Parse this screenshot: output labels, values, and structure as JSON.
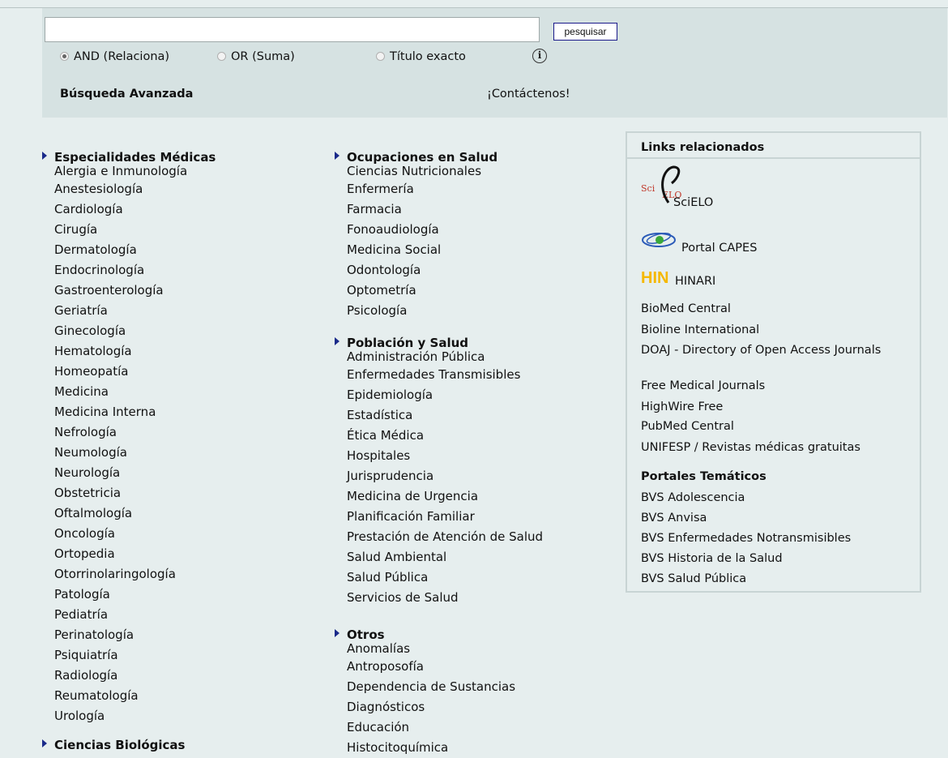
{
  "search": {
    "button_label": "pesquisar",
    "options": [
      "AND (Relaciona)",
      "OR (Suma)",
      "Título exacto"
    ],
    "selected_option": "AND (Relaciona)",
    "advanced_label": "Búsqueda Avanzada",
    "contact_label": "¡Contáctenos!"
  },
  "columns": {
    "especialidades": {
      "title": "Especialidades Médicas",
      "items": [
        "Alergia e Inmunología",
        "Anestesiología",
        "Cardiología",
        "Cirugía",
        "Dermatología",
        "Endocrinología",
        "Gastroenterología",
        "Geriatría",
        "Ginecología",
        "Hematología",
        "Homeopatía",
        "Medicina",
        "Medicina Interna",
        "Nefrología",
        "Neumología",
        "Neurología",
        "Obstetricia",
        "Oftalmología",
        "Oncología",
        "Ortopedia",
        "Otorrinolaringología",
        "Patología",
        "Pediatría",
        "Perinatología",
        "Psiquiatría",
        "Radiología",
        "Reumatología",
        "Urología"
      ]
    },
    "biologicas": {
      "title": "Ciencias Biológicas"
    },
    "ocupaciones": {
      "title": "Ocupaciones en Salud",
      "items": [
        "Ciencias Nutricionales",
        "Enfermería",
        "Farmacia",
        "Fonoaudiología",
        "Medicina Social",
        "Odontología",
        "Optometría",
        "Psicología"
      ]
    },
    "poblacion": {
      "title": "Población y Salud",
      "items": [
        "Administración Pública",
        "Enfermedades Transmisibles",
        "Epidemiología",
        "Estadística",
        "Ética Médica",
        "Hospitales",
        "Jurisprudencia",
        "Medicina de Urgencia",
        "Planificación Familiar",
        "Prestación de Atención de Salud",
        "Salud Ambiental",
        "Salud Pública",
        "Servicios de Salud"
      ]
    },
    "otros": {
      "title": "Otros",
      "items": [
        "Anomalías",
        "Antroposofía",
        "Dependencia de Sustancias",
        "Diagnósticos",
        "Educación",
        "Histocitoquímica"
      ]
    }
  },
  "related": {
    "title": "Links relacionados",
    "logo_links": [
      {
        "label": "SciELO",
        "icon": "scielo-logo"
      },
      {
        "label": "Portal CAPES",
        "icon": "capes-logo"
      },
      {
        "label": "HINARI",
        "icon": "hinari-logo",
        "logo_text": "HIN"
      }
    ],
    "links": [
      "BioMed Central",
      "Bioline International",
      "DOAJ - Directory of Open Access Journals",
      "Free Medical Journals",
      "HighWire Free",
      "PubMed Central",
      "UNIFESP / Revistas médicas gratuitas"
    ],
    "portales_title": "Portales Temáticos",
    "portales": [
      "BVS Adolescencia",
      "BVS Anvisa",
      "BVS Enfermedades Notransmisibles",
      "BVS Historia de la Salud",
      "BVS Salud Pública"
    ]
  },
  "colors": {
    "page_bg": "#e6eeee",
    "search_bg": "#d6e2e2",
    "arrow": "#1a2a8a",
    "hinari_orange": "#f5b800"
  }
}
